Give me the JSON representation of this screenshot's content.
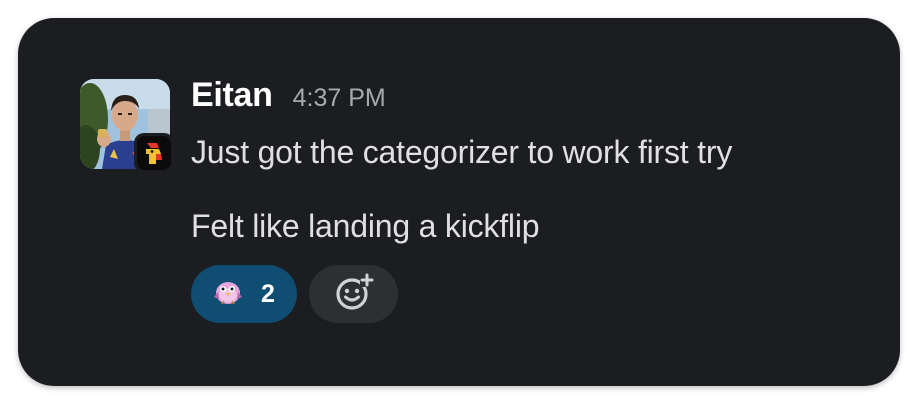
{
  "message": {
    "author": "Eitan",
    "timestamp": "4:37 PM",
    "lines": [
      "Just got the categorizer to work first try",
      "Felt like landing a kickflip"
    ]
  },
  "reactions": [
    {
      "emoji": "bird-emoji-icon",
      "count": "2",
      "active": true
    }
  ],
  "add_reaction_icon": "add-reaction-icon",
  "avatar_badge_icon": "app-badge-icon",
  "colors": {
    "card_background": "#1b1d21",
    "reaction_active": "#0f4d73",
    "add_reaction_background": "#2d2f33",
    "author_text": "#ffffff",
    "timestamp_text": "#a8a9ab"
  }
}
